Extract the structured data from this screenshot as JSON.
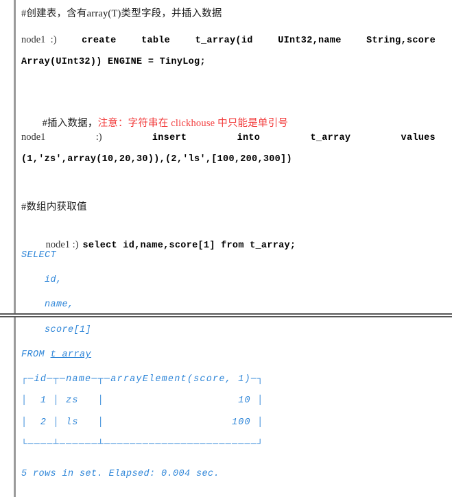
{
  "block_top": {
    "section_create": {
      "comment_prefix": "#创建表，含有array(T)类型字段，并插入数据",
      "prompt": "node1  :)",
      "sql_line1_parts": [
        "create",
        "table",
        "t_array(id",
        "UInt32,name",
        "String,score"
      ],
      "sql_line2": "Array(UInt32)) ENGINE = TinyLog;"
    },
    "section_insert": {
      "comment_black": "#插入数据，",
      "comment_red": "注意：字符串在 clickhouse 中只能是单引号",
      "prompt": "node1",
      "prompt_smiley": ":)",
      "sql_line1_parts": [
        "insert",
        "into",
        "t_array",
        "values"
      ],
      "sql_line2": "(1,'zs',array(10,20,30)),(2,'ls',[100,200,300])"
    },
    "section_select": {
      "comment": "#数组内获取值",
      "prompt": "node1 :)",
      "sql": "select id,name,score[1] from t_array;",
      "echo_keyword": "SELECT",
      "echo_col1": "    id,",
      "echo_col2": "    name,"
    }
  },
  "block_bottom": {
    "echo_col3": "    score[1]",
    "echo_from_keyword": "FROM",
    "echo_from_table": "t_array",
    "result_table": {
      "top_border": "┌─id─┬─name─┬─arrayElement(score, 1)─┐",
      "rows": [
        "│  1 │ zs   │                     10 │",
        "│  2 │ ls   │                    100 │"
      ],
      "bottom_border": "└────┴──────┴────────────────────────┘"
    },
    "status_line": "5 rows in set. Elapsed: 0.004 sec."
  },
  "colors": {
    "output_blue": "#2f86d8",
    "warning_red": "#f23c3c",
    "rail_gray": "#9a9a9a",
    "divider_gray": "#555555",
    "text_black": "#000000"
  }
}
